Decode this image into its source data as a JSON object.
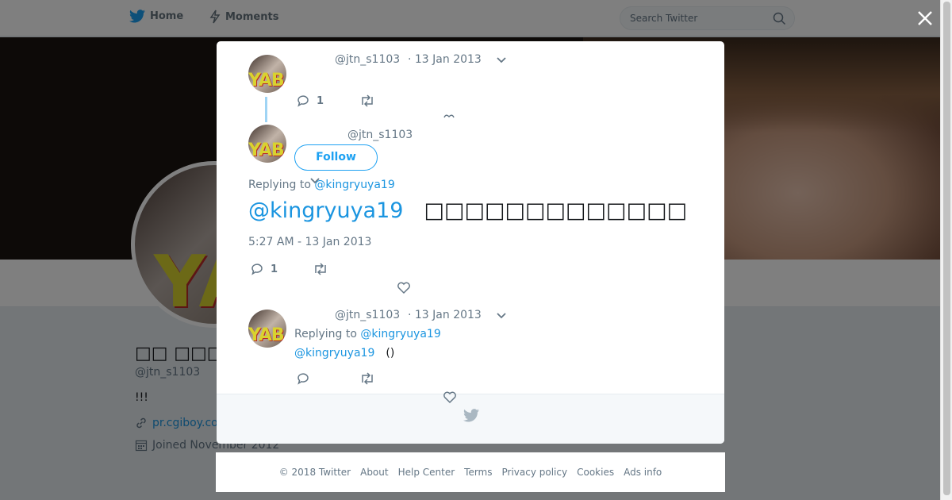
{
  "nav": {
    "home_label": "Home",
    "moments_label": "Moments"
  },
  "search": {
    "placeholder": "Search Twitter"
  },
  "profile": {
    "name": "□□ □□□",
    "handle": "@jtn_s1103",
    "bio": "!!!",
    "link": "pr.cgiboy.co",
    "joined": "Joined November 2012"
  },
  "tweets": [
    {
      "handle": "@jtn_s1103",
      "time": "· 13 Jan 2013",
      "reply_count": "1"
    },
    {
      "handle": "@jtn_s1103",
      "follow_label": "Follow",
      "replying_prefix": "Replying to",
      "replying_to": "@kingryuya19",
      "text_mention": "@kingryuya19",
      "text_body": "□□□□□□□□□□□□□",
      "datetime": "5:27 AM - 13 Jan 2013",
      "reply_count": "1"
    },
    {
      "handle": "@jtn_s1103",
      "time": "· 13 Jan 2013",
      "replying_prefix": "Replying to",
      "replying_to": "@kingryuya19",
      "text_mention": "@kingryuya19",
      "text_body": "()"
    }
  ],
  "footer": {
    "copyright": "© 2018 Twitter",
    "links": [
      "About",
      "Help Center",
      "Terms",
      "Privacy policy",
      "Cookies",
      "Ads info"
    ]
  },
  "colors": {
    "accent": "#1da1f2",
    "link": "#1b95e0",
    "muted": "#657786",
    "thread_line": "#9fd4f4"
  }
}
